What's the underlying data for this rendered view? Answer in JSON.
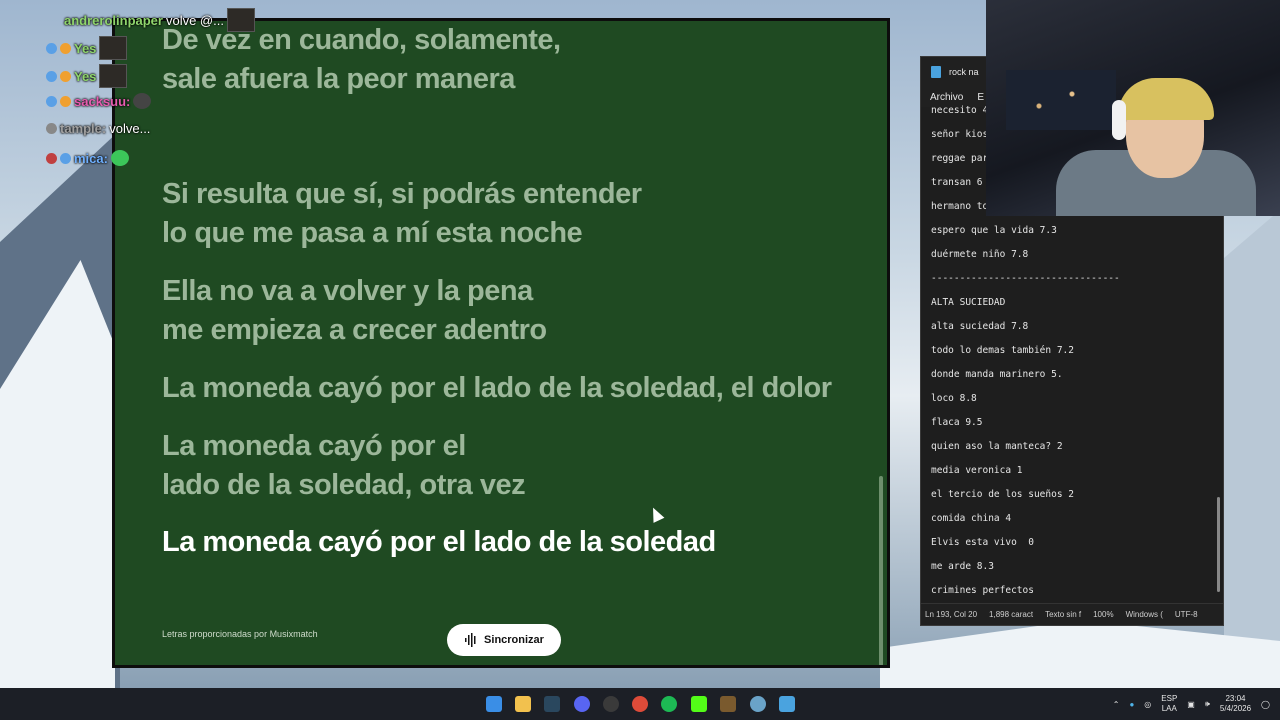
{
  "lyrics": {
    "lines": [
      "De vez en cuando, solamente,\nsale afuera la peor manera",
      "Si resulta que sí, si podrás entender\nlo que me pasa a mí esta noche",
      "Ella no va a volver y la pena\nme empieza a crecer adentro",
      "La moneda cayó por el lado de la soledad, el dolor",
      "La moneda cayó por el\nlado de la soledad, otra vez",
      "La moneda cayó por el lado de la soledad"
    ],
    "active_index": 5,
    "credits": "Letras proporcionadas por Musixmatch",
    "sync_label": "Sincronizar"
  },
  "chat": [
    {
      "name": "andrerolinpaper",
      "msg": "volve @..."
    },
    {
      "name": "Yes",
      "msg": ""
    },
    {
      "name": "Yes",
      "msg": ""
    },
    {
      "name": "sacksuu:",
      "msg": ""
    },
    {
      "name": "tample:",
      "msg": "volve..."
    },
    {
      "name": "mica:",
      "msg": ""
    }
  ],
  "notepad": {
    "title": "rock na",
    "menu": [
      "Archivo",
      "E"
    ],
    "lines": [
      "necesito 4",
      "señor kios",
      "reggae par",
      "transan 6",
      "hermano to",
      "espero que la vida 7.3",
      "duérmete niño 7.8",
      "---------------------------------",
      "ALTA SUCIEDAD",
      "alta suciedad 7.8",
      "todo lo demas también 7.2",
      "donde manda marinero 5.",
      "loco 8.8",
      "flaca 9.5",
      "quien aso la manteca? 2",
      "media veronica 1",
      "el tercio de los sueños 2",
      "comida china 4",
      "Elvis esta vivo  0",
      "me arde 8.3",
      "crimines perfectos"
    ],
    "status": [
      "Ln 193, Col 20",
      "1,898 caract",
      "Texto sin f",
      "100%",
      "Windows (",
      "UTF-8"
    ]
  },
  "taskbar": {
    "lang_top": "ESP",
    "lang_bottom": "LAA",
    "time": "23:04",
    "date": "5/4/2026"
  },
  "colors": {
    "lyrics_bg": "#1f4a22",
    "lyric_inactive": "#9cb79a",
    "lyric_active": "#ffffff"
  }
}
